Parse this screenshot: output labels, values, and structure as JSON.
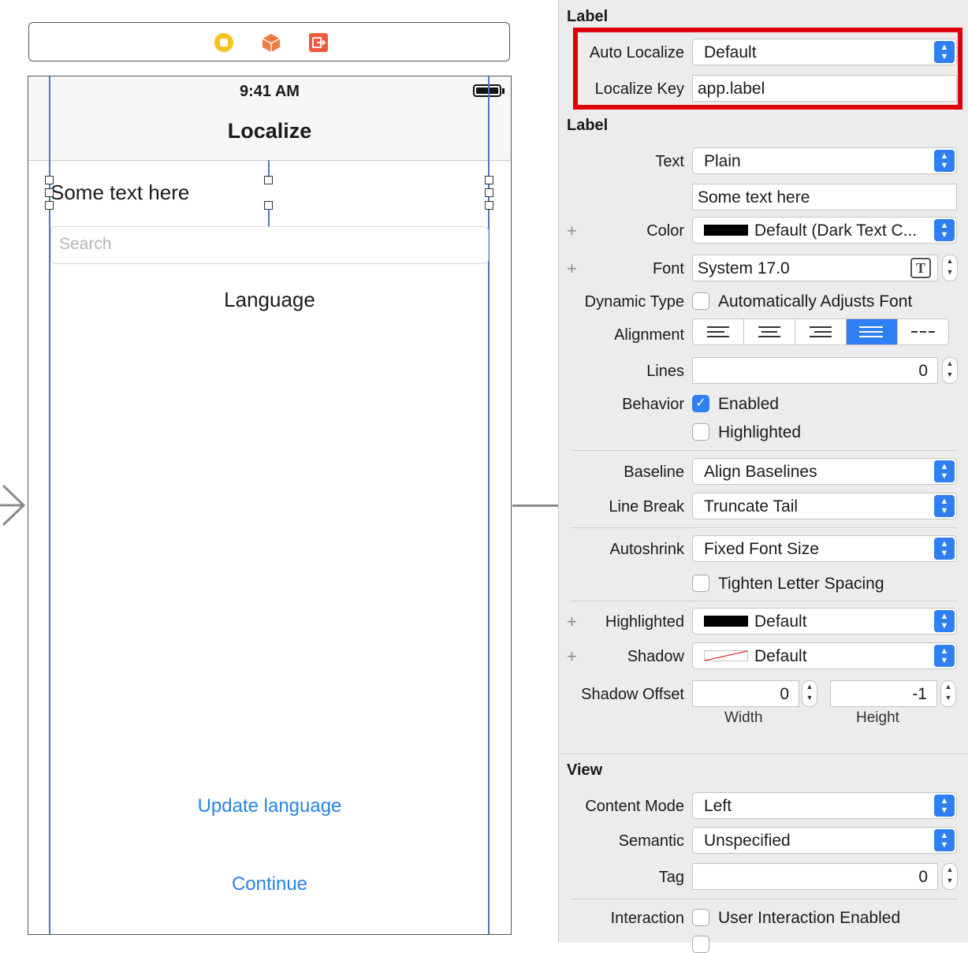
{
  "canvas": {
    "status_time": "9:41 AM",
    "nav_title": "Localize",
    "label_text": "Some text here",
    "search_placeholder": "Search",
    "language_label": "Language",
    "update_button": "Update language",
    "continue_button": "Continue",
    "dock_icons": [
      "view-controller-icon",
      "first-responder-icon",
      "exit-icon"
    ]
  },
  "inspector": {
    "localize_section": {
      "title": "Label",
      "auto_localize_label": "Auto Localize",
      "auto_localize_value": "Default",
      "localize_key_label": "Localize Key",
      "localize_key_value": "app.label"
    },
    "label_section": {
      "title": "Label",
      "text_label": "Text",
      "text_value": "Plain",
      "text_content": "Some text here",
      "color_label": "Color",
      "color_value": "Default (Dark Text C...",
      "font_label": "Font",
      "font_value": "System 17.0",
      "dynamic_type_label": "Dynamic Type",
      "dynamic_type_option": "Automatically Adjusts Font",
      "alignment_label": "Alignment",
      "lines_label": "Lines",
      "lines_value": "0",
      "behavior_label": "Behavior",
      "enabled_label": "Enabled",
      "highlighted_option": "Highlighted",
      "baseline_label": "Baseline",
      "baseline_value": "Align Baselines",
      "line_break_label": "Line Break",
      "line_break_value": "Truncate Tail",
      "autoshrink_label": "Autoshrink",
      "autoshrink_value": "Fixed Font Size",
      "tighten_option": "Tighten Letter Spacing",
      "highlighted_label": "Highlighted",
      "highlighted_value": "Default",
      "shadow_label": "Shadow",
      "shadow_value": "Default",
      "shadow_offset_label": "Shadow Offset",
      "shadow_width_value": "0",
      "shadow_height_value": "-1",
      "width_caption": "Width",
      "height_caption": "Height"
    },
    "view_section": {
      "title": "View",
      "content_mode_label": "Content Mode",
      "content_mode_value": "Left",
      "semantic_label": "Semantic",
      "semantic_value": "Unspecified",
      "tag_label": "Tag",
      "tag_value": "0",
      "interaction_label": "Interaction",
      "user_interaction_option": "User Interaction Enabled"
    }
  },
  "colors": {
    "accent": "#2f7ff3",
    "highlight_box": "#e0000b",
    "link": "#2a82e4"
  }
}
